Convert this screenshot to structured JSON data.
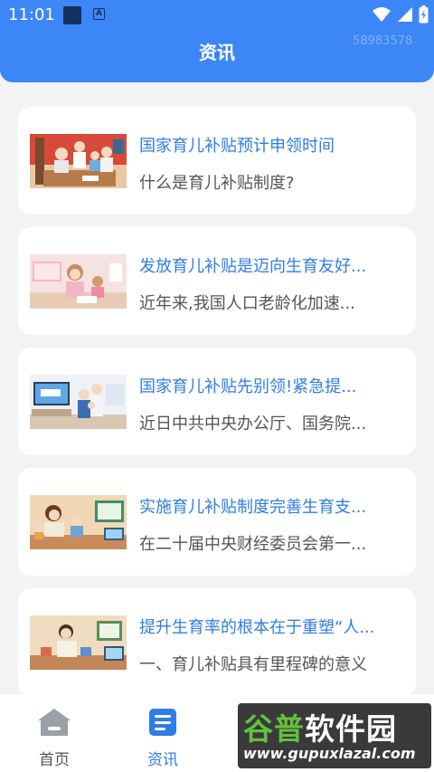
{
  "status_bar": {
    "time": "11:01",
    "badge_letter": "A"
  },
  "header": {
    "title": "资讯",
    "corner_number": "58983578"
  },
  "articles": [
    {
      "title": "国家育儿补贴预计申领时间",
      "summary": "什么是育儿补贴制度?"
    },
    {
      "title": "发放育儿补贴是迈向生育友好...",
      "summary": "近年来,我国人口老龄化加速..."
    },
    {
      "title": "国家育儿补贴先别领!紧急提...",
      "summary": "近日中共中央办公厅、国务院..."
    },
    {
      "title": "实施育儿补贴制度完善生育支...",
      "summary": "在二十届中央财经委员会第一..."
    },
    {
      "title": "提升生育率的根本在于重塑“人...",
      "summary": "一、育儿补贴具有里程碑的意义"
    }
  ],
  "bottom_nav": {
    "items": [
      {
        "label": "首页",
        "icon": "home-icon",
        "active": false
      },
      {
        "label": "资讯",
        "icon": "news-icon",
        "active": true
      }
    ]
  },
  "watermark": {
    "logo_text_green": "谷普",
    "logo_text_white": "软件园",
    "url": "www.gupuxlazal.com"
  },
  "colors": {
    "primary": "#3d86f8",
    "title_text": "#2f7de6",
    "background": "#f2f3f5"
  }
}
